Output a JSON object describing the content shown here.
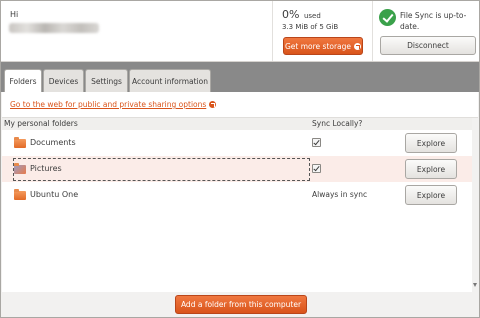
{
  "header": {
    "greeting": "Hi",
    "usage_percent": "0%",
    "usage_suffix": "used",
    "usage_detail": "3.3 MiB of 5 GiB",
    "get_storage_label": "Get more storage",
    "sync_status": "File Sync is up-to-date.",
    "disconnect_label": "Disconnect"
  },
  "tabs": [
    {
      "label": "Folders",
      "active": true
    },
    {
      "label": "Devices"
    },
    {
      "label": "Settings"
    },
    {
      "label": "Account information"
    }
  ],
  "main": {
    "web_link": "Go to the web for public and private sharing options",
    "columns": {
      "name": "My personal folders",
      "sync": "Sync Locally?"
    },
    "folders": [
      {
        "name": "Documents",
        "sync_checked": true,
        "action": "Explore"
      },
      {
        "name": "Pictures",
        "sync_checked": true,
        "action": "Explore",
        "selected": true
      },
      {
        "name": "Ubuntu One",
        "sync_text": "Always in sync",
        "action": "Explore"
      }
    ]
  },
  "footer": {
    "add_folder_label": "Add a folder from this computer"
  },
  "colors": {
    "accent": "#d9541b",
    "sync_ok": "#3aa14a",
    "tabbar": "#898989"
  }
}
